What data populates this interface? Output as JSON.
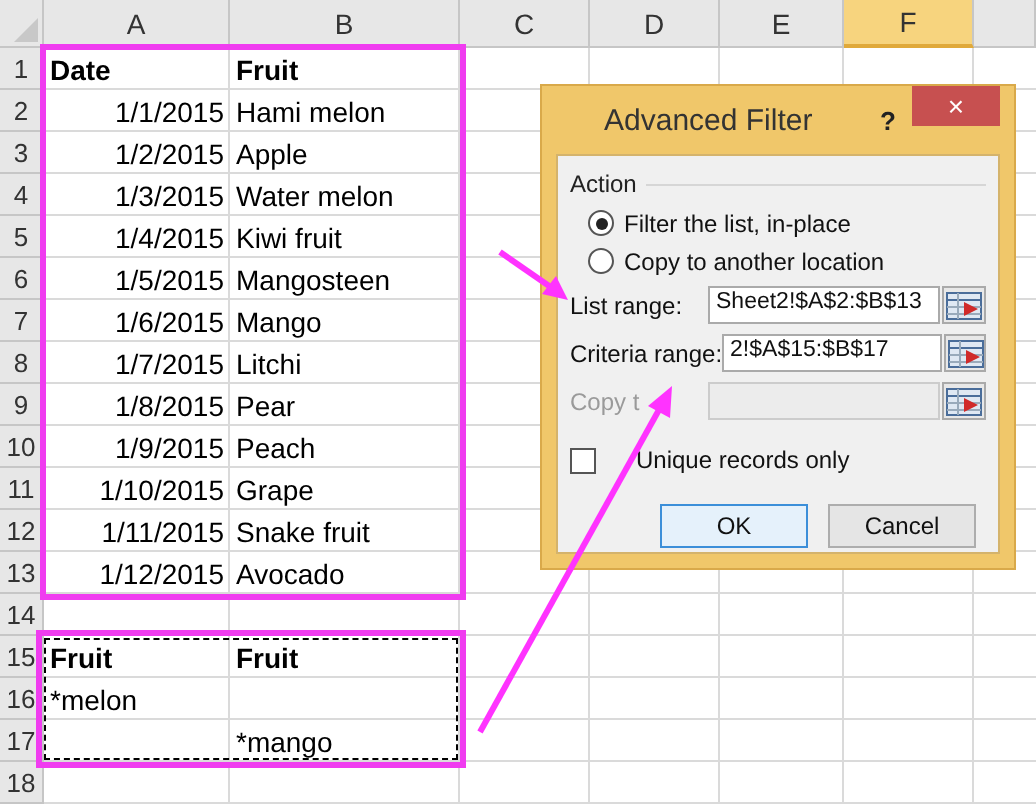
{
  "sheet": {
    "columns": [
      {
        "label": "A",
        "selected": false
      },
      {
        "label": "B",
        "selected": false
      },
      {
        "label": "C",
        "selected": false
      },
      {
        "label": "D",
        "selected": false
      },
      {
        "label": "E",
        "selected": false
      },
      {
        "label": "F",
        "selected": true
      }
    ],
    "rows": [
      {
        "number": "1",
        "kind": "header",
        "a": "Date",
        "b": "Fruit"
      },
      {
        "number": "2",
        "kind": "data",
        "a": "1/1/2015",
        "b": "Hami melon"
      },
      {
        "number": "3",
        "kind": "data",
        "a": "1/2/2015",
        "b": "Apple"
      },
      {
        "number": "4",
        "kind": "data",
        "a": "1/3/2015",
        "b": "Water melon"
      },
      {
        "number": "5",
        "kind": "data",
        "a": "1/4/2015",
        "b": "Kiwi fruit"
      },
      {
        "number": "6",
        "kind": "data",
        "a": "1/5/2015",
        "b": "Mangosteen"
      },
      {
        "number": "7",
        "kind": "data",
        "a": "1/6/2015",
        "b": "Mango"
      },
      {
        "number": "8",
        "kind": "data",
        "a": "1/7/2015",
        "b": "Litchi"
      },
      {
        "number": "9",
        "kind": "data",
        "a": "1/8/2015",
        "b": "Pear"
      },
      {
        "number": "10",
        "kind": "data",
        "a": "1/9/2015",
        "b": "Peach"
      },
      {
        "number": "11",
        "kind": "data",
        "a": "1/10/2015",
        "b": "Grape"
      },
      {
        "number": "12",
        "kind": "data",
        "a": "1/11/2015",
        "b": "Snake fruit"
      },
      {
        "number": "13",
        "kind": "data",
        "a": "1/12/2015",
        "b": "Avocado"
      },
      {
        "number": "14",
        "kind": "empty"
      },
      {
        "number": "15",
        "kind": "header",
        "a": "Fruit",
        "b": "Fruit"
      },
      {
        "number": "16",
        "kind": "criteria",
        "a": "*melon"
      },
      {
        "number": "17",
        "kind": "criteria",
        "b": "*mango"
      },
      {
        "number": "18",
        "kind": "empty"
      }
    ]
  },
  "dialog": {
    "title": "Advanced Filter",
    "help": "?",
    "close": "×",
    "action_label": "Action",
    "radios": [
      {
        "label": "Filter the list, in-place",
        "selected": true
      },
      {
        "label": "Copy to another location",
        "selected": false
      }
    ],
    "fields": [
      {
        "label": "List range:",
        "value": "Sheet2!$A$2:$B$13",
        "disabled": false
      },
      {
        "label": "Criteria range:",
        "value": "2!$A$15:$B$17",
        "disabled": false
      },
      {
        "label": "Copy t",
        "disabled": true
      }
    ],
    "unique": {
      "label": "Unique records only",
      "checked": false
    },
    "buttons": [
      {
        "label": "OK",
        "default": true
      },
      {
        "label": "Cancel",
        "default": false
      }
    ]
  }
}
